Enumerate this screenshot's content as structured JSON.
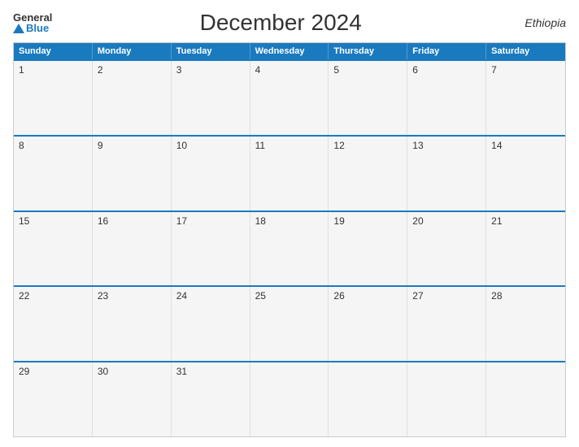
{
  "header": {
    "logo_general": "General",
    "logo_blue": "Blue",
    "title": "December 2024",
    "country": "Ethiopia"
  },
  "calendar": {
    "day_headers": [
      "Sunday",
      "Monday",
      "Tuesday",
      "Wednesday",
      "Thursday",
      "Friday",
      "Saturday"
    ],
    "weeks": [
      [
        {
          "num": "1",
          "empty": false
        },
        {
          "num": "2",
          "empty": false
        },
        {
          "num": "3",
          "empty": false
        },
        {
          "num": "4",
          "empty": false
        },
        {
          "num": "5",
          "empty": false
        },
        {
          "num": "6",
          "empty": false
        },
        {
          "num": "7",
          "empty": false
        }
      ],
      [
        {
          "num": "8",
          "empty": false
        },
        {
          "num": "9",
          "empty": false
        },
        {
          "num": "10",
          "empty": false
        },
        {
          "num": "11",
          "empty": false
        },
        {
          "num": "12",
          "empty": false
        },
        {
          "num": "13",
          "empty": false
        },
        {
          "num": "14",
          "empty": false
        }
      ],
      [
        {
          "num": "15",
          "empty": false
        },
        {
          "num": "16",
          "empty": false
        },
        {
          "num": "17",
          "empty": false
        },
        {
          "num": "18",
          "empty": false
        },
        {
          "num": "19",
          "empty": false
        },
        {
          "num": "20",
          "empty": false
        },
        {
          "num": "21",
          "empty": false
        }
      ],
      [
        {
          "num": "22",
          "empty": false
        },
        {
          "num": "23",
          "empty": false
        },
        {
          "num": "24",
          "empty": false
        },
        {
          "num": "25",
          "empty": false
        },
        {
          "num": "26",
          "empty": false
        },
        {
          "num": "27",
          "empty": false
        },
        {
          "num": "28",
          "empty": false
        }
      ],
      [
        {
          "num": "29",
          "empty": false
        },
        {
          "num": "30",
          "empty": false
        },
        {
          "num": "31",
          "empty": false
        },
        {
          "num": "",
          "empty": true
        },
        {
          "num": "",
          "empty": true
        },
        {
          "num": "",
          "empty": true
        },
        {
          "num": "",
          "empty": true
        }
      ]
    ]
  }
}
